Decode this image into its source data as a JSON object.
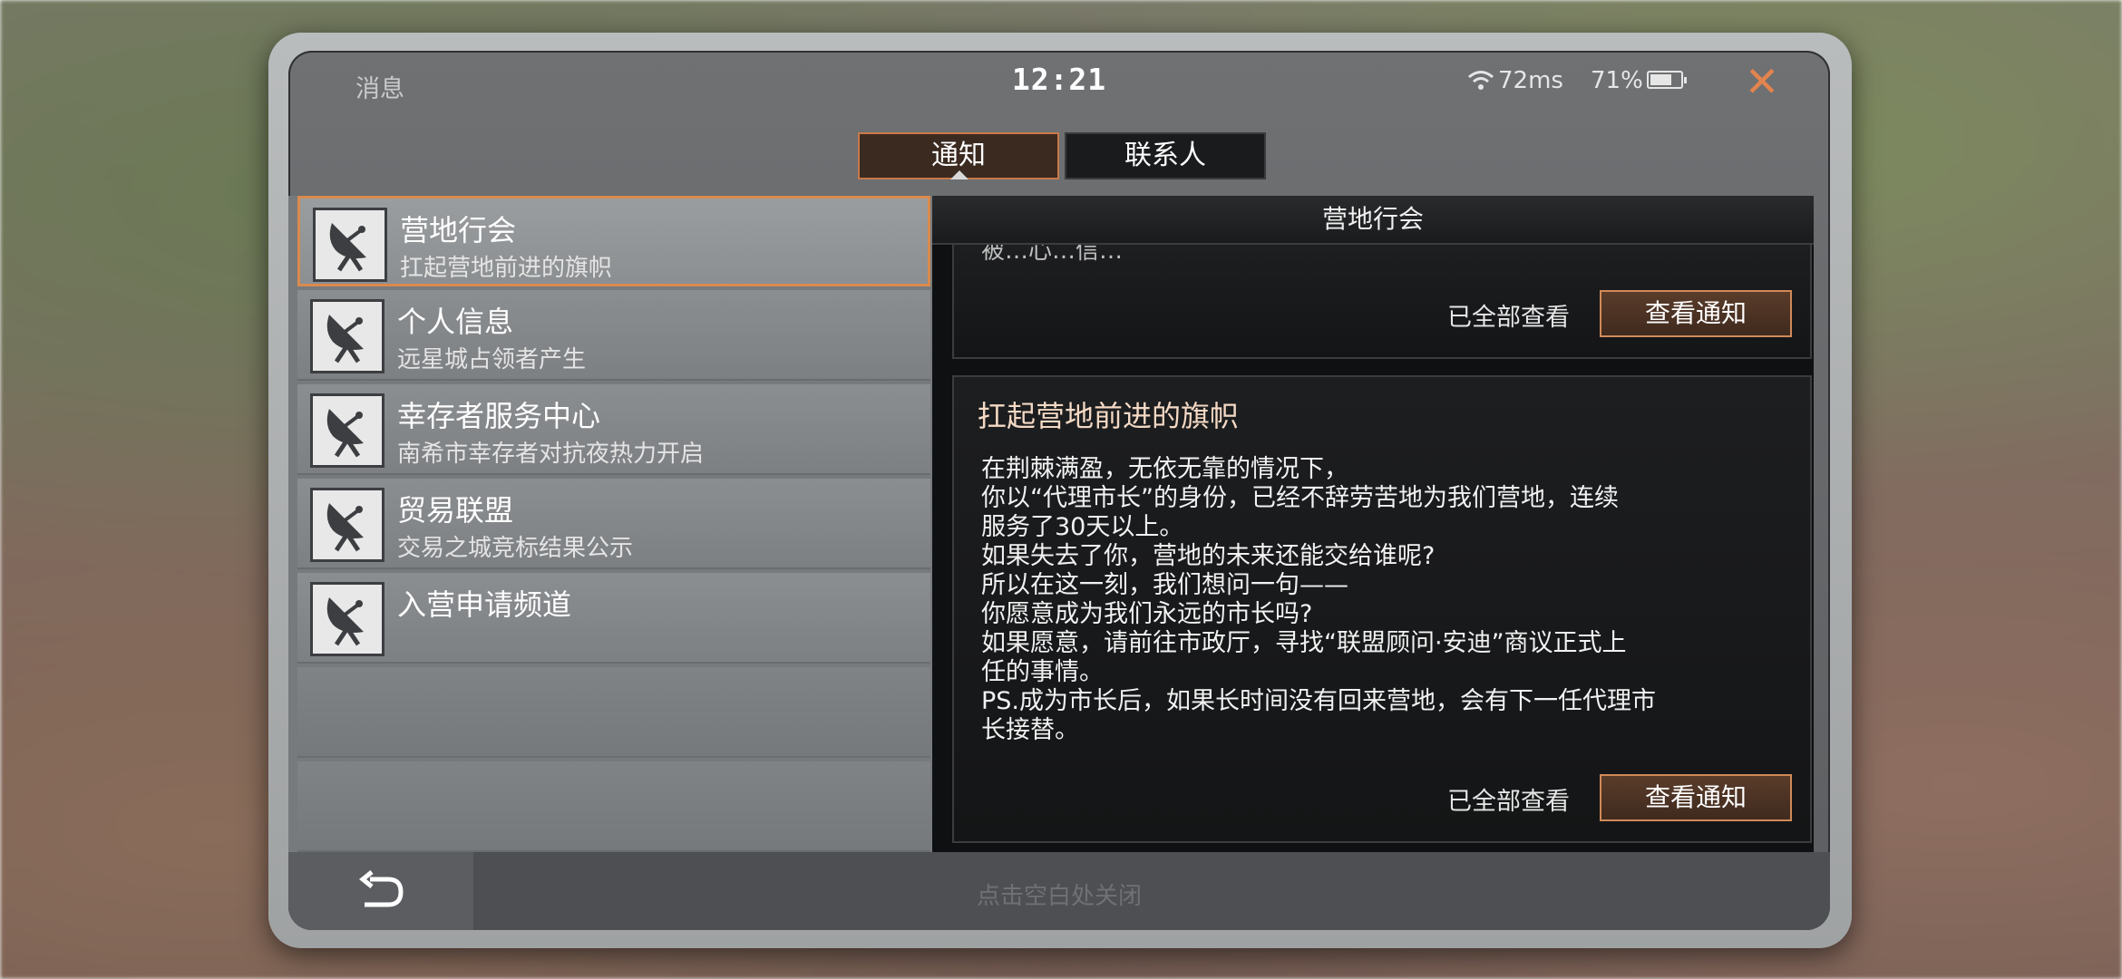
{
  "status_bar": {
    "app_name": "消息",
    "time": "12:21",
    "ping": "72ms",
    "battery_percent": "71%",
    "battery_level": 0.71,
    "close_icon": "close-icon"
  },
  "tabs": [
    {
      "label": "通知",
      "active": true
    },
    {
      "label": "联系人",
      "active": false
    }
  ],
  "channels": [
    {
      "title": "营地行会",
      "subtitle": "扛起营地前进的旗帜",
      "icon": "satellite-dish-icon",
      "selected": true
    },
    {
      "title": "个人信息",
      "subtitle": "远星城占领者产生",
      "icon": "satellite-dish-icon",
      "selected": false
    },
    {
      "title": "幸存者服务中心",
      "subtitle": "南希市幸存者对抗夜热力开启",
      "icon": "satellite-dish-icon",
      "selected": false
    },
    {
      "title": "贸易联盟",
      "subtitle": "交易之城竞标结果公示",
      "icon": "satellite-dish-icon",
      "selected": false
    },
    {
      "title": "入营申请频道",
      "subtitle": "",
      "icon": "satellite-dish-icon",
      "selected": false
    }
  ],
  "panel": {
    "header": "营地行会",
    "cards": [
      {
        "cut_text": "被…心…信…",
        "title": "",
        "body": "",
        "viewed_label": "已全部查看",
        "button_label": "查看通知"
      },
      {
        "cut_text": "",
        "title": "扛起营地前进的旗帜",
        "body": "在荆棘满盈，无依无靠的情况下，\n你以“代理市长”的身份，已经不辞劳苦地为我们营地，连续\n服务了30天以上。\n如果失去了你，营地的未来还能交给谁呢?\n所以在这一刻，我们想问一句——\n你愿意成为我们永远的市长吗?\n如果愿意，请前往市政厅，寻找“联盟顾问·安迪”商议正式上\n任的事情。\nPS.成为市长后，如果长时间没有回来营地，会有下一任代理市\n长接替。",
        "viewed_label": "已全部查看",
        "button_label": "查看通知"
      }
    ]
  },
  "bottom_bar": {
    "back_icon": "back-arrow-icon",
    "close_hint": "点击空白处关闭"
  },
  "colors": {
    "accent": "#d98a4e",
    "close_icon": "#e2844d"
  }
}
